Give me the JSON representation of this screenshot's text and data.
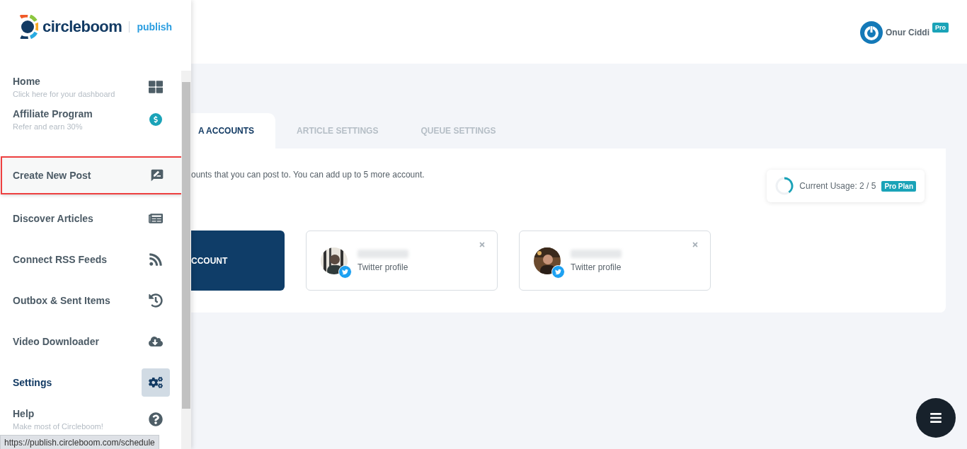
{
  "logo": {
    "name": "circleboom",
    "product": "publish"
  },
  "sidebar": {
    "items": [
      {
        "kind": "sub",
        "label": "Home",
        "subtitle": "Click here for your dashboard",
        "selected": false,
        "highlighted": false
      },
      {
        "kind": "sub",
        "label": "Affiliate Program",
        "subtitle": "Refer and earn 30%",
        "selected": false,
        "highlighted": false
      },
      {
        "kind": "spacer"
      },
      {
        "kind": "main",
        "label": "Create New Post",
        "selected": false,
        "highlighted": true
      },
      {
        "kind": "main",
        "label": "Discover Articles",
        "selected": false,
        "highlighted": false
      },
      {
        "kind": "main",
        "label": "Connect RSS Feeds",
        "selected": false,
        "highlighted": false
      },
      {
        "kind": "main",
        "label": "Outbox & Sent Items",
        "selected": false,
        "highlighted": false
      },
      {
        "kind": "main",
        "label": "Video Downloader",
        "selected": false,
        "highlighted": false
      },
      {
        "kind": "main",
        "label": "Settings",
        "selected": true,
        "highlighted": false
      },
      {
        "kind": "sub",
        "label": "Help",
        "subtitle": "Make most of Circleboom!",
        "selected": false,
        "highlighted": false
      }
    ]
  },
  "status_url": "https://publish.circleboom.com/schedule",
  "user": {
    "name": "Onur Ciddi",
    "badge": "Pro"
  },
  "tabs": [
    {
      "label": "A ACCOUNTS",
      "selected": true
    },
    {
      "label": "ARTICLE SETTINGS",
      "selected": false
    },
    {
      "label": "QUEUE SETTINGS",
      "selected": false
    }
  ],
  "info_text": "ounts that you can post to. You can add up to 5 more account.",
  "usage": {
    "label": "Current Usage: 2 / 5",
    "badge": "Pro Plan",
    "level": 0.4
  },
  "add_button": "CCOUNT",
  "accounts": [
    {
      "kind": "picture",
      "type": "Twitter profile"
    },
    {
      "kind": "picture",
      "type": "Twitter profile"
    }
  ]
}
